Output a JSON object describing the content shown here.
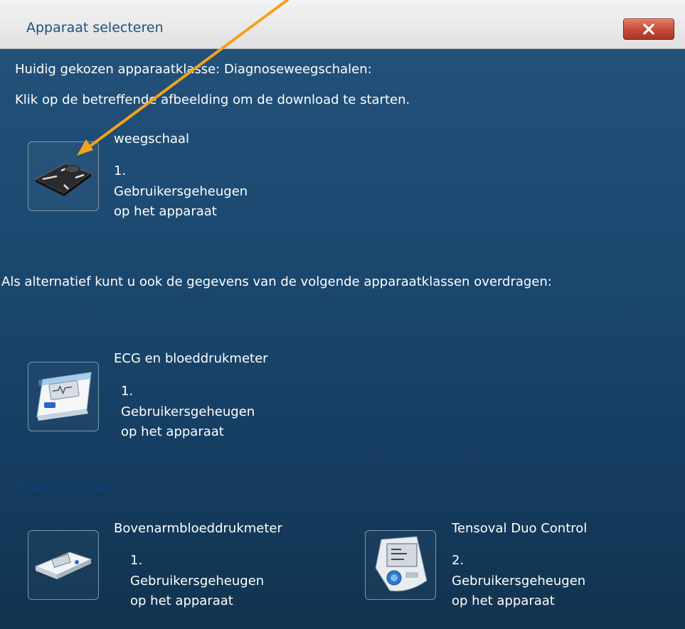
{
  "window": {
    "title": "Apparaat selecteren"
  },
  "current_class_line": "Huidig gekozen apparaatklasse: Diagnoseweegschalen:",
  "instruction": "Klik op de betreffende afbeelding om de download te starten.",
  "primary_device": {
    "name": "weegschaal",
    "number": "1.",
    "desc_line1": "Gebruikersgeheugen",
    "desc_line2": "op het apparaat",
    "icon": "scale-icon"
  },
  "alternative_text": "Als alternatief kunt u ook de gegevens van de volgende apparaatklassen overdragen:",
  "ecg_device": {
    "name": "ECG en bloeddrukmeter",
    "number": "1.",
    "desc_line1": "Gebruikersgeheugen",
    "desc_line2": "op het apparaat",
    "icon": "ecg-monitor-icon"
  },
  "bp_section_label": "Bloeddrukmeters:",
  "bp_devices": [
    {
      "name": "Bovenarmbloeddrukmeter",
      "number": "1.",
      "desc_line1": "Gebruikersgeheugen",
      "desc_line2": "op het apparaat",
      "icon": "upper-arm-bp-monitor-icon"
    },
    {
      "name": "Tensoval Duo Control",
      "number": "2.",
      "desc_line1": "Gebruikersgeheugen",
      "desc_line2": "op het apparaat",
      "icon": "tensoval-monitor-icon"
    }
  ],
  "colors": {
    "background_top": "#24527a",
    "background_bottom": "#11334f",
    "close_button": "#c74a35",
    "arrow": "#f2a31b",
    "section_label": "#143f74"
  }
}
